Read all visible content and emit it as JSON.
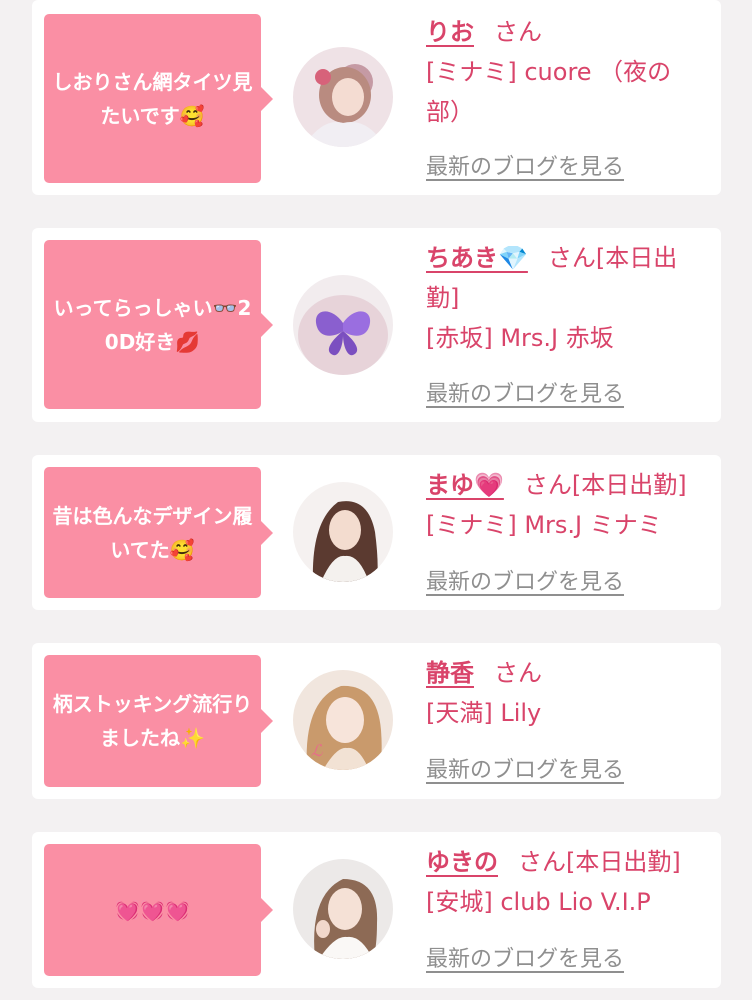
{
  "posts": [
    {
      "comment": "しおりさん網タイツ見たいです🥰",
      "name": "りお",
      "suffix": "さん",
      "shop": "[ミナミ] cuore （夜の部）",
      "link": "最新のブログを見る"
    },
    {
      "comment": "いってらっしゃい👓20D好き💋",
      "name": "ちあき💎",
      "suffix": "さん[本日出勤]",
      "shop": "[赤坂] Mrs.J 赤坂",
      "link": "最新のブログを見る"
    },
    {
      "comment": "昔は色んなデザイン履いてた🥰",
      "name": "まゆ💗",
      "suffix": "さん[本日出勤]",
      "shop": "[ミナミ] Mrs.J ミナミ",
      "link": "最新のブログを見る"
    },
    {
      "comment": "柄ストッキング流行りましたね✨",
      "name": "静香",
      "suffix": "さん",
      "shop": "[天満] Lily",
      "link": "最新のブログを見る"
    },
    {
      "comment": "💓💓💓",
      "name": "ゆきの",
      "suffix": "さん[本日出勤]",
      "shop": "[安城] club Lio V.I.P",
      "link": "最新のブログを見る"
    }
  ],
  "colors": {
    "bubble": "#fa8fa4",
    "accent": "#d9446a",
    "link": "#8f8f8f",
    "background": "#f3f1f2"
  }
}
